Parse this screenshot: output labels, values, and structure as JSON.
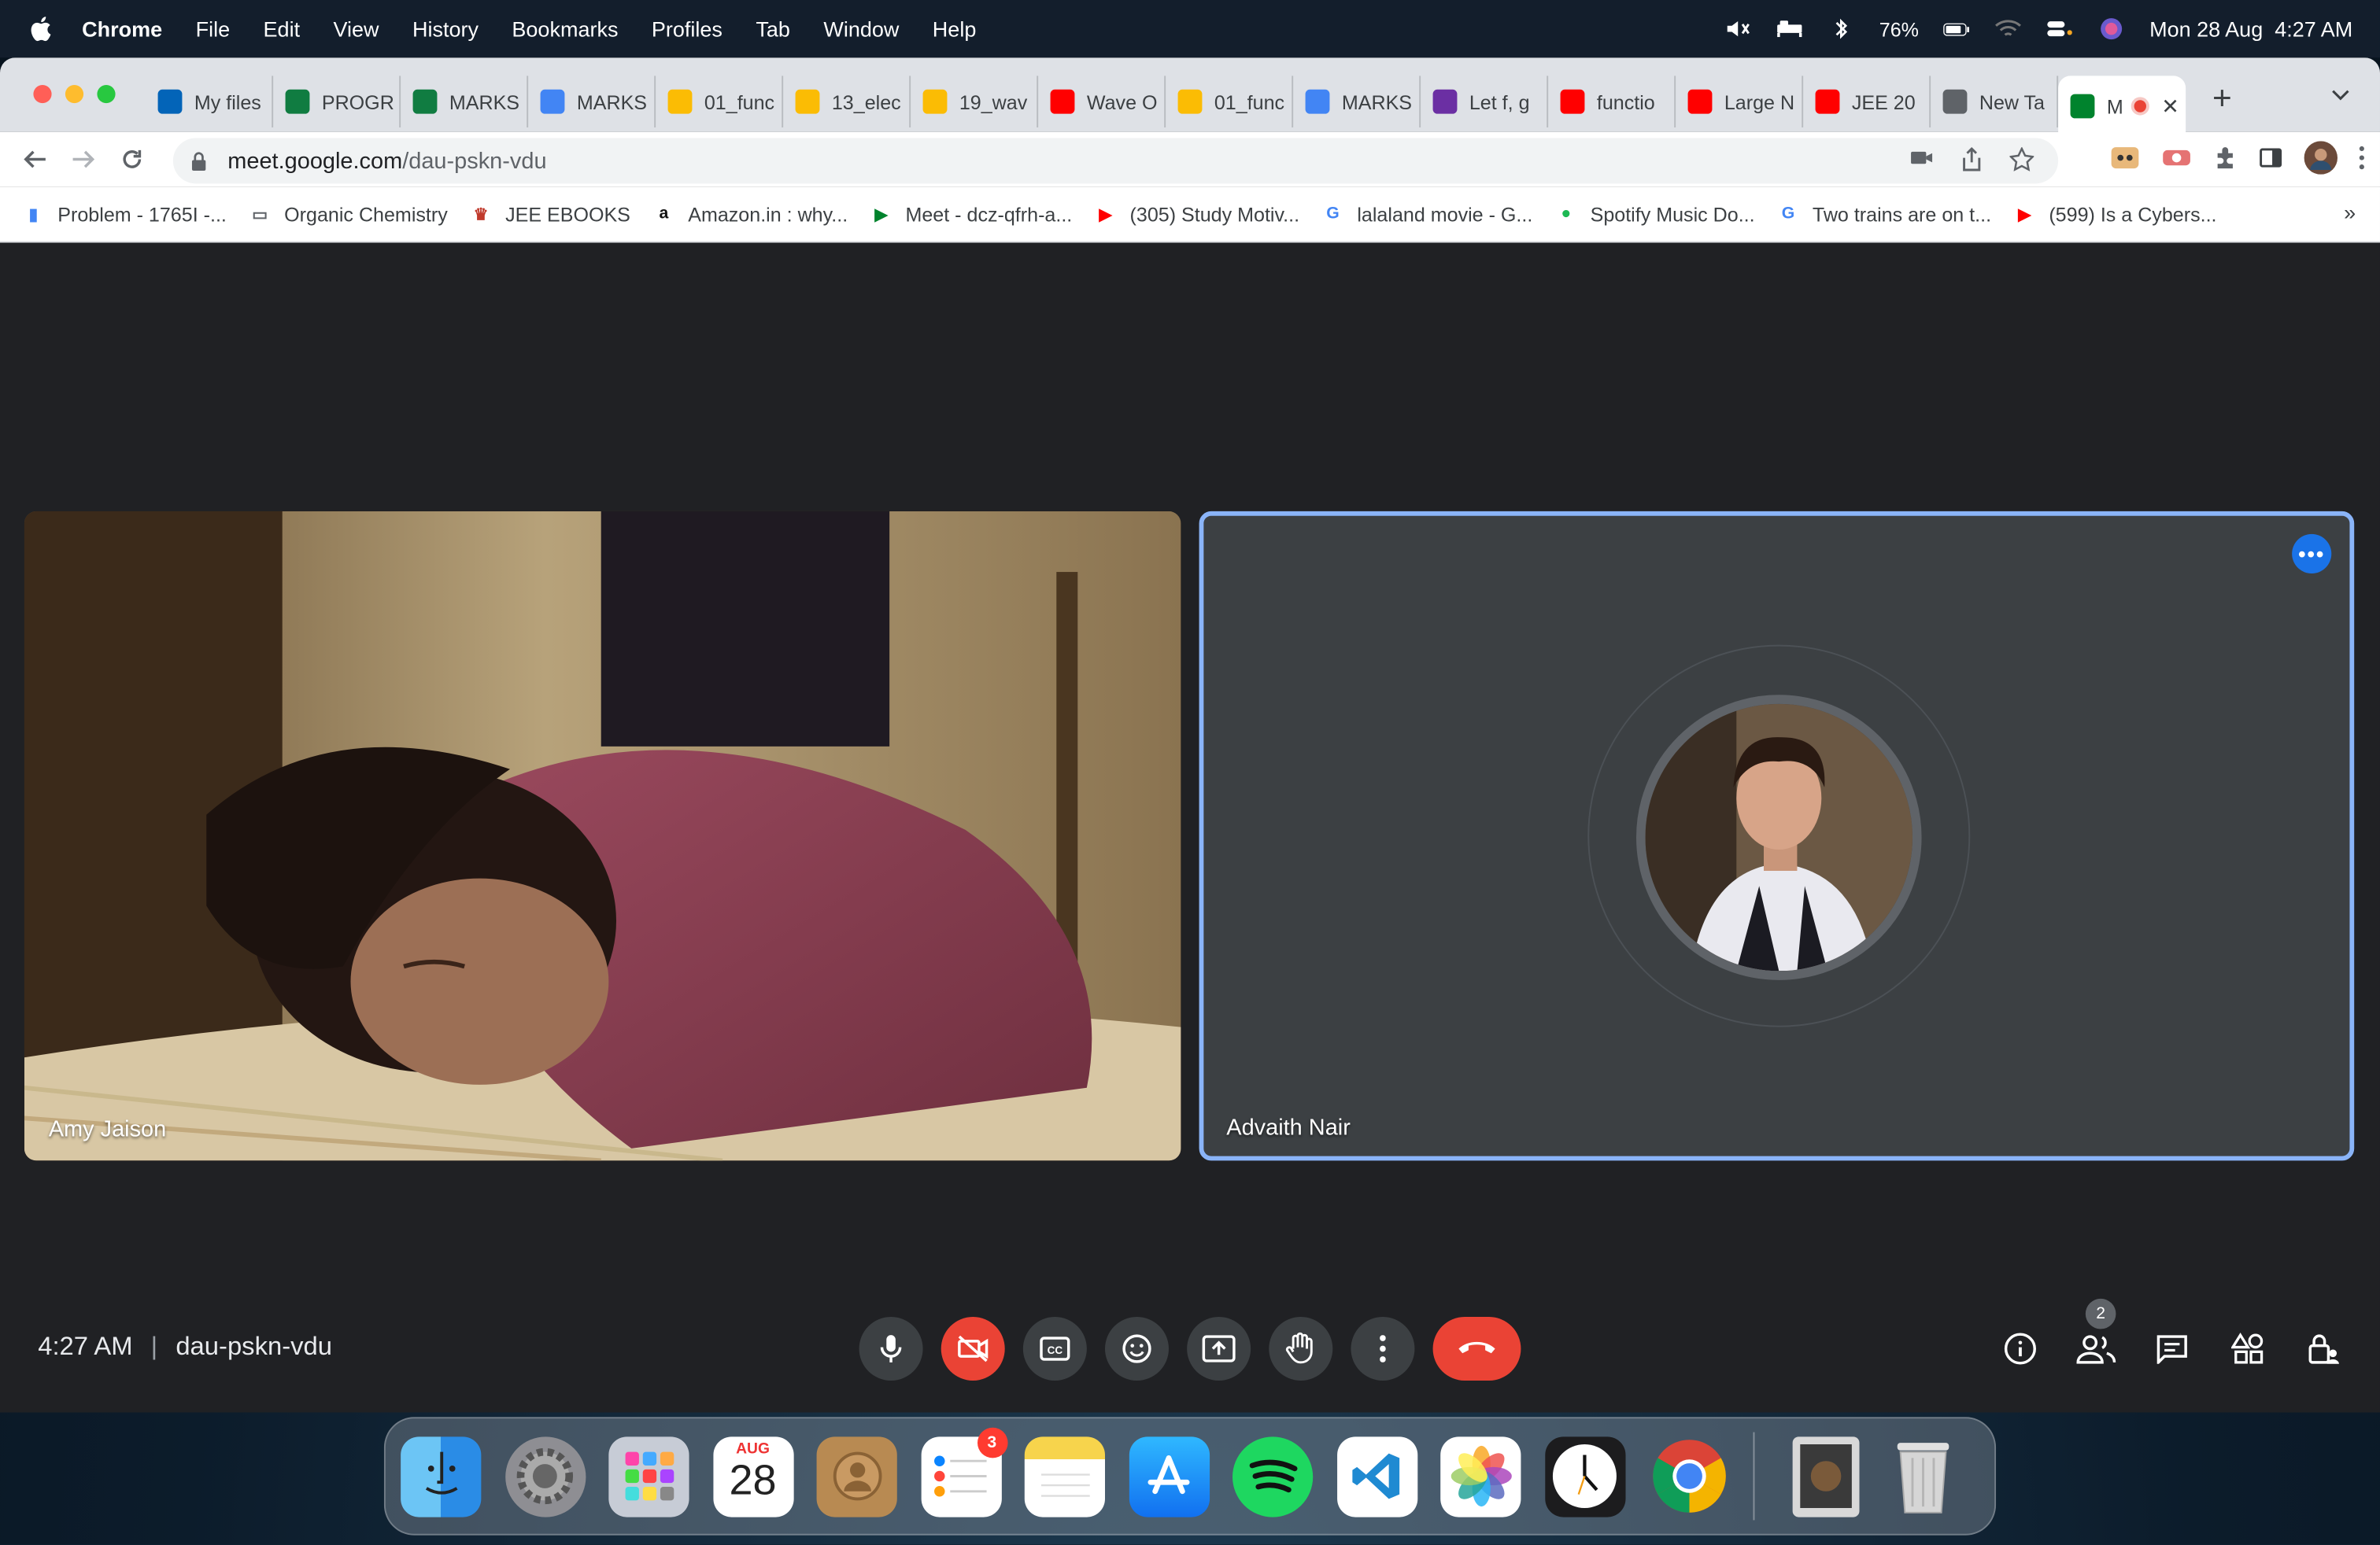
{
  "menubar": {
    "app": "Chrome",
    "items": [
      "File",
      "Edit",
      "View",
      "History",
      "Bookmarks",
      "Profiles",
      "Tab",
      "Window",
      "Help"
    ],
    "battery": "76%",
    "datetime": "Mon 28 Aug  4:27 AM"
  },
  "tabs": [
    {
      "label": "My files",
      "icon": "onedrive-icon",
      "color": "#0364b8"
    },
    {
      "label": "PROGRESS",
      "icon": "excel-icon",
      "color": "#107c41"
    },
    {
      "label": "MARKS",
      "icon": "excel-icon",
      "color": "#107c41"
    },
    {
      "label": "MARKS",
      "icon": "docs-icon",
      "color": "#4285f4"
    },
    {
      "label": "01_func",
      "icon": "drive-icon",
      "color": "#fbbc04"
    },
    {
      "label": "13_elec",
      "icon": "drive-icon",
      "color": "#fbbc04"
    },
    {
      "label": "19_wav",
      "icon": "drive-icon",
      "color": "#fbbc04"
    },
    {
      "label": "Wave O",
      "icon": "youtube-icon",
      "color": "#ff0000"
    },
    {
      "label": "01_func",
      "icon": "drive-icon",
      "color": "#fbbc04"
    },
    {
      "label": "MARKS",
      "icon": "docs-icon",
      "color": "#4285f4"
    },
    {
      "label": "Let f, g",
      "icon": "b-icon",
      "color": "#6b2fa3"
    },
    {
      "label": "functio",
      "icon": "youtube-icon",
      "color": "#ff0000"
    },
    {
      "label": "Large N",
      "icon": "youtube-icon",
      "color": "#ff0000"
    },
    {
      "label": "JEE 20",
      "icon": "youtube-icon",
      "color": "#ff0000"
    },
    {
      "label": "New Ta",
      "icon": "chrome-icon",
      "color": "#5f6368"
    }
  ],
  "active_tab": {
    "label": "M"
  },
  "omnibox": {
    "host": "meet.google.com",
    "path": "/dau-pskn-vdu"
  },
  "bookmarks": [
    {
      "label": "Problem - 1765I -...",
      "icon": "chart-icon"
    },
    {
      "label": "Organic Chemistry",
      "icon": "folder-icon"
    },
    {
      "label": "JEE EBOOKS",
      "icon": "ebook-icon"
    },
    {
      "label": "Amazon.in : why...",
      "icon": "amazon-icon"
    },
    {
      "label": "Meet - dcz-qfrh-a...",
      "icon": "meet-icon"
    },
    {
      "label": "(305) Study Motiv...",
      "icon": "youtube-icon"
    },
    {
      "label": "lalaland movie - G...",
      "icon": "google-icon"
    },
    {
      "label": "Spotify Music Do...",
      "icon": "spotify-icon"
    },
    {
      "label": "Two trains are on t...",
      "icon": "google-icon"
    },
    {
      "label": "(599) Is a Cybers...",
      "icon": "youtube-icon"
    }
  ],
  "meet": {
    "participant1": "Amy Jaison",
    "participant2": "Advaith Nair",
    "time": "4:27 AM",
    "code": "dau-pskn-vdu",
    "participant_count": "2"
  },
  "dock": {
    "calendar_month": "AUG",
    "calendar_day": "28",
    "reminders_badge": "3"
  }
}
